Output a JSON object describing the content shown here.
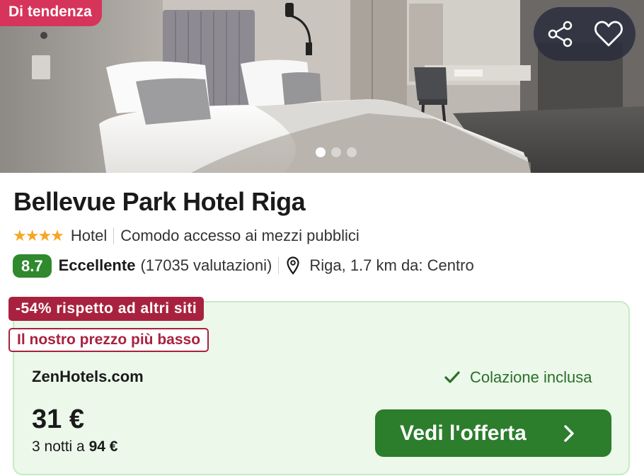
{
  "hero": {
    "badge": "Di tendenza",
    "share_icon": "share-icon",
    "favorite_icon": "heart-outline-icon",
    "slides_total": 3,
    "slide_active_index": 0
  },
  "hotel": {
    "name": "Bellevue Park Hotel Riga",
    "stars": 4,
    "stars_display": "★★★★",
    "type": "Hotel",
    "feature": "Comodo accesso ai mezzi pubblici",
    "score": "8.7",
    "rating_label": "Eccellente",
    "reviews": "(17035 valutazioni)",
    "location": "Riga, 1.7 km da: Centro"
  },
  "offer": {
    "discount_badge": "-54% rispetto ad altri siti",
    "lowest_badge": "Il nostro prezzo più basso",
    "provider": "ZenHotels.com",
    "amenity": "Colazione inclusa",
    "price": "31 €",
    "nights_prefix": "3 notti a ",
    "nights_total": "94 €",
    "cta_label": "Vedi l'offerta"
  },
  "colors": {
    "trend_badge": "#d6345a",
    "score_bg": "#2e8a2c",
    "discount": "#a8223f",
    "card_bg": "#ebf8ea",
    "cta_bg": "#2c7d2c",
    "star": "#f5a623"
  }
}
